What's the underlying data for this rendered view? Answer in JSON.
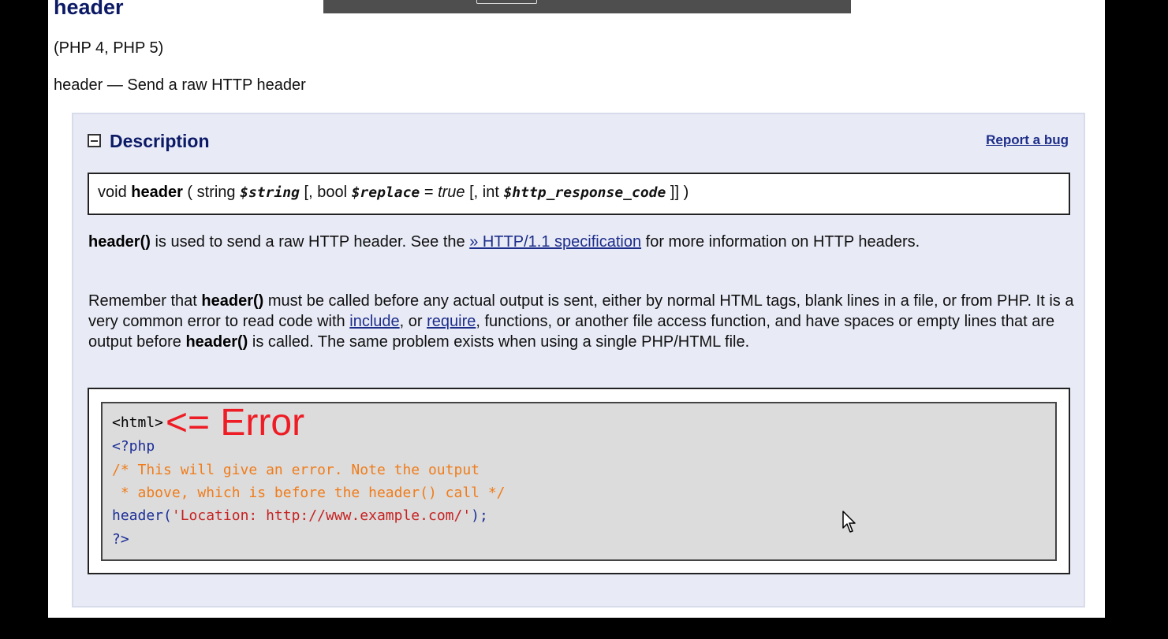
{
  "function_name": "header",
  "version": "(PHP 4, PHP 5)",
  "refname": "header — Send a raw HTTP header",
  "description": {
    "title": "Description",
    "report_link": "Report a bug",
    "signature": {
      "return_type": "void",
      "name": "header",
      "open": " ( ",
      "p1_type": "string ",
      "p1_var": "$string",
      "p2_prefix": " [, bool ",
      "p2_var": "$replace",
      "p2_eq": " = ",
      "p2_val": "true",
      "p3_prefix": " [, int ",
      "p3_var": "$http_response_code",
      "close": " ]] )"
    },
    "para1": {
      "fn": "header()",
      "text1": " is used to send a raw HTTP header. See the ",
      "link": "» HTTP/1.1 specification",
      "text2": " for more information on HTTP headers."
    },
    "para2": {
      "t1": "Remember that ",
      "fn1": "header()",
      "t2": " must be called before any actual output is sent, either by normal HTML tags, blank lines in a file, or from PHP. It is a very common error to read code with ",
      "link1": "include",
      "t3": ", or ",
      "link2": "require",
      "t4": ", functions, or another file access function, and have spaces or empty lines that are output before ",
      "fn2": "header()",
      "t5": " is called. The same problem exists when using a single PHP/HTML file."
    }
  },
  "example": {
    "line1": "<html>",
    "line2": "<?php",
    "line3": "/* This will give an error. Note the output",
    "line4": " * above, which is before the header() call */",
    "line5_fn": "header",
    "line5_open": "(",
    "line5_str": "'Location: http://www.example.com/'",
    "line5_close": ");",
    "line6": "?>",
    "annotation": "<= Error"
  },
  "colors": {
    "title": "#0c1a66",
    "link": "#1d2d8a",
    "code_keyword": "#1b2d96",
    "code_comment": "#f07c1a",
    "code_string": "#c62222",
    "annotation": "#ee1c25"
  }
}
